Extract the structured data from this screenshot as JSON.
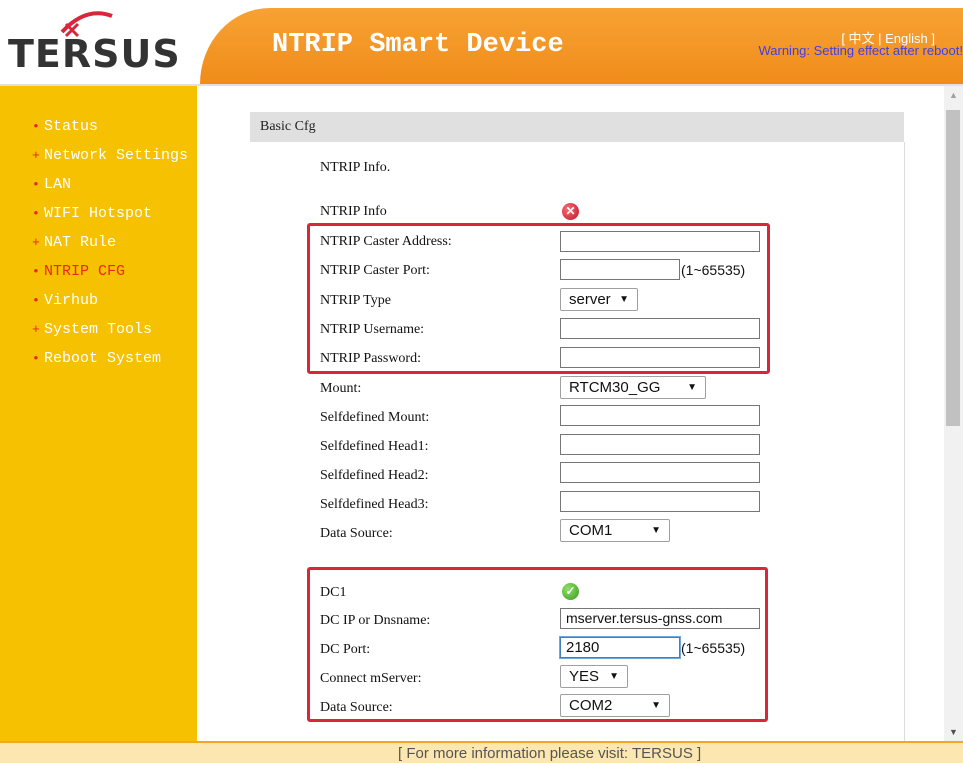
{
  "header": {
    "logo_text": "TERSUS",
    "title": "NTRIP Smart Device",
    "lang_switch": "[ 中文 | English ]",
    "warning": "Warning: Setting effect after reboot!"
  },
  "sidebar": {
    "items": [
      {
        "label": "Status",
        "bullet": "•",
        "active": false
      },
      {
        "label": "Network Settings",
        "bullet": "+",
        "active": false
      },
      {
        "label": "LAN",
        "bullet": "•",
        "active": false
      },
      {
        "label": "WIFI Hotspot",
        "bullet": "•",
        "active": false
      },
      {
        "label": "NAT Rule",
        "bullet": "+",
        "active": false
      },
      {
        "label": "NTRIP CFG",
        "bullet": "•",
        "active": true
      },
      {
        "label": "Virhub",
        "bullet": "•",
        "active": false
      },
      {
        "label": "System Tools",
        "bullet": "+",
        "active": false
      },
      {
        "label": "Reboot System",
        "bullet": "•",
        "active": false
      }
    ]
  },
  "panel": {
    "heading": "Basic Cfg",
    "section_title": "NTRIP Info.",
    "ntrip_info_label": "NTRIP Info",
    "ntrip_info_status": "error",
    "caster_address": {
      "label": "NTRIP Caster Address:",
      "value": ""
    },
    "caster_port": {
      "label": "NTRIP Caster Port:",
      "value": "",
      "hint": "(1~65535)"
    },
    "ntrip_type": {
      "label": "NTRIP Type",
      "value": "server"
    },
    "username": {
      "label": "NTRIP Username:",
      "value": ""
    },
    "password": {
      "label": "NTRIP Password:",
      "value": ""
    },
    "mount": {
      "label": "Mount:",
      "value": "RTCM30_GG"
    },
    "self_mount": {
      "label": "Selfdefined Mount:",
      "value": ""
    },
    "self_head1": {
      "label": "Selfdefined Head1:",
      "value": ""
    },
    "self_head2": {
      "label": "Selfdefined Head2:",
      "value": ""
    },
    "self_head3": {
      "label": "Selfdefined Head3:",
      "value": ""
    },
    "data_source_1": {
      "label": "Data Source:",
      "value": "COM1"
    },
    "dc1_label": "DC1",
    "dc1_status": "ok",
    "dc_ip": {
      "label": "DC IP or Dnsname:",
      "value": "mserver.tersus-gnss.com"
    },
    "dc_port": {
      "label": "DC Port:",
      "value": "2180",
      "hint": "(1~65535)"
    },
    "connect_mserver": {
      "label": "Connect mServer:",
      "value": "YES"
    },
    "data_source_2": {
      "label": "Data Source:",
      "value": "COM2"
    }
  },
  "footer": {
    "text": "[ For more information please visit: TERSUS ]"
  },
  "colors": {
    "accent_orange": "#f08c1a",
    "sidebar_yellow": "#f5c100",
    "highlight_red": "#d9263a"
  }
}
